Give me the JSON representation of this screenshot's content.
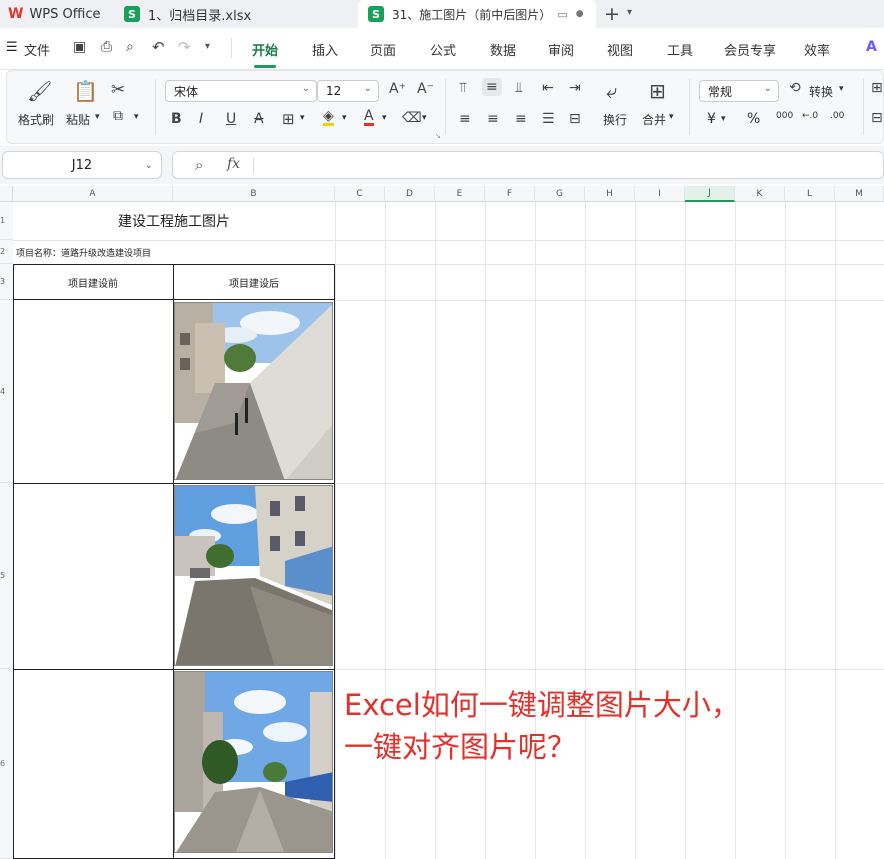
{
  "tabs": [
    {
      "label": "WPS Office",
      "logo": "W"
    },
    {
      "label": "1、归档目录.xlsx",
      "icon": "S"
    },
    {
      "label": "31、施工图片（前中后图片）",
      "icon": "S"
    }
  ],
  "tab_controls": {
    "new_tab": "+",
    "more": "⌄"
  },
  "menu": {
    "file": "文件",
    "items": [
      "开始",
      "插入",
      "页面",
      "公式",
      "数据",
      "审阅",
      "视图",
      "工具",
      "会员专享",
      "效率"
    ],
    "active": "开始"
  },
  "ribbon": {
    "format_painter": "格式刷",
    "paste": "粘贴",
    "font_name": "宋体",
    "font_size": "12",
    "wrap": "换行",
    "merge": "合并",
    "number_format": "常规",
    "convert": "转换",
    "currency": "¥",
    "percent": "%",
    "thousands": "000",
    "inc_dec": "←.0",
    "dec_dec": ".00"
  },
  "formula_bar": {
    "name_box": "J12",
    "fx": "fx",
    "formula": ""
  },
  "columns": [
    "A",
    "B",
    "C",
    "D",
    "E",
    "F",
    "G",
    "H",
    "I",
    "J",
    "K",
    "L",
    "M"
  ],
  "selected_column": "J",
  "rows": [
    "1",
    "2",
    "3",
    "4",
    "5",
    "6"
  ],
  "sheet": {
    "title": "建设工程施工图片",
    "project_label": "项目名称：道路升级改造建设项目",
    "before_header": "项目建设前",
    "after_header": "项目建设后"
  },
  "overlay": {
    "line1": "Excel如何一键调整图片大小，",
    "line2": "一键对齐图片呢？",
    "color": "#e5302a"
  },
  "colors": {
    "accent": "#1a9a5a",
    "wps_red": "#e8342c"
  }
}
